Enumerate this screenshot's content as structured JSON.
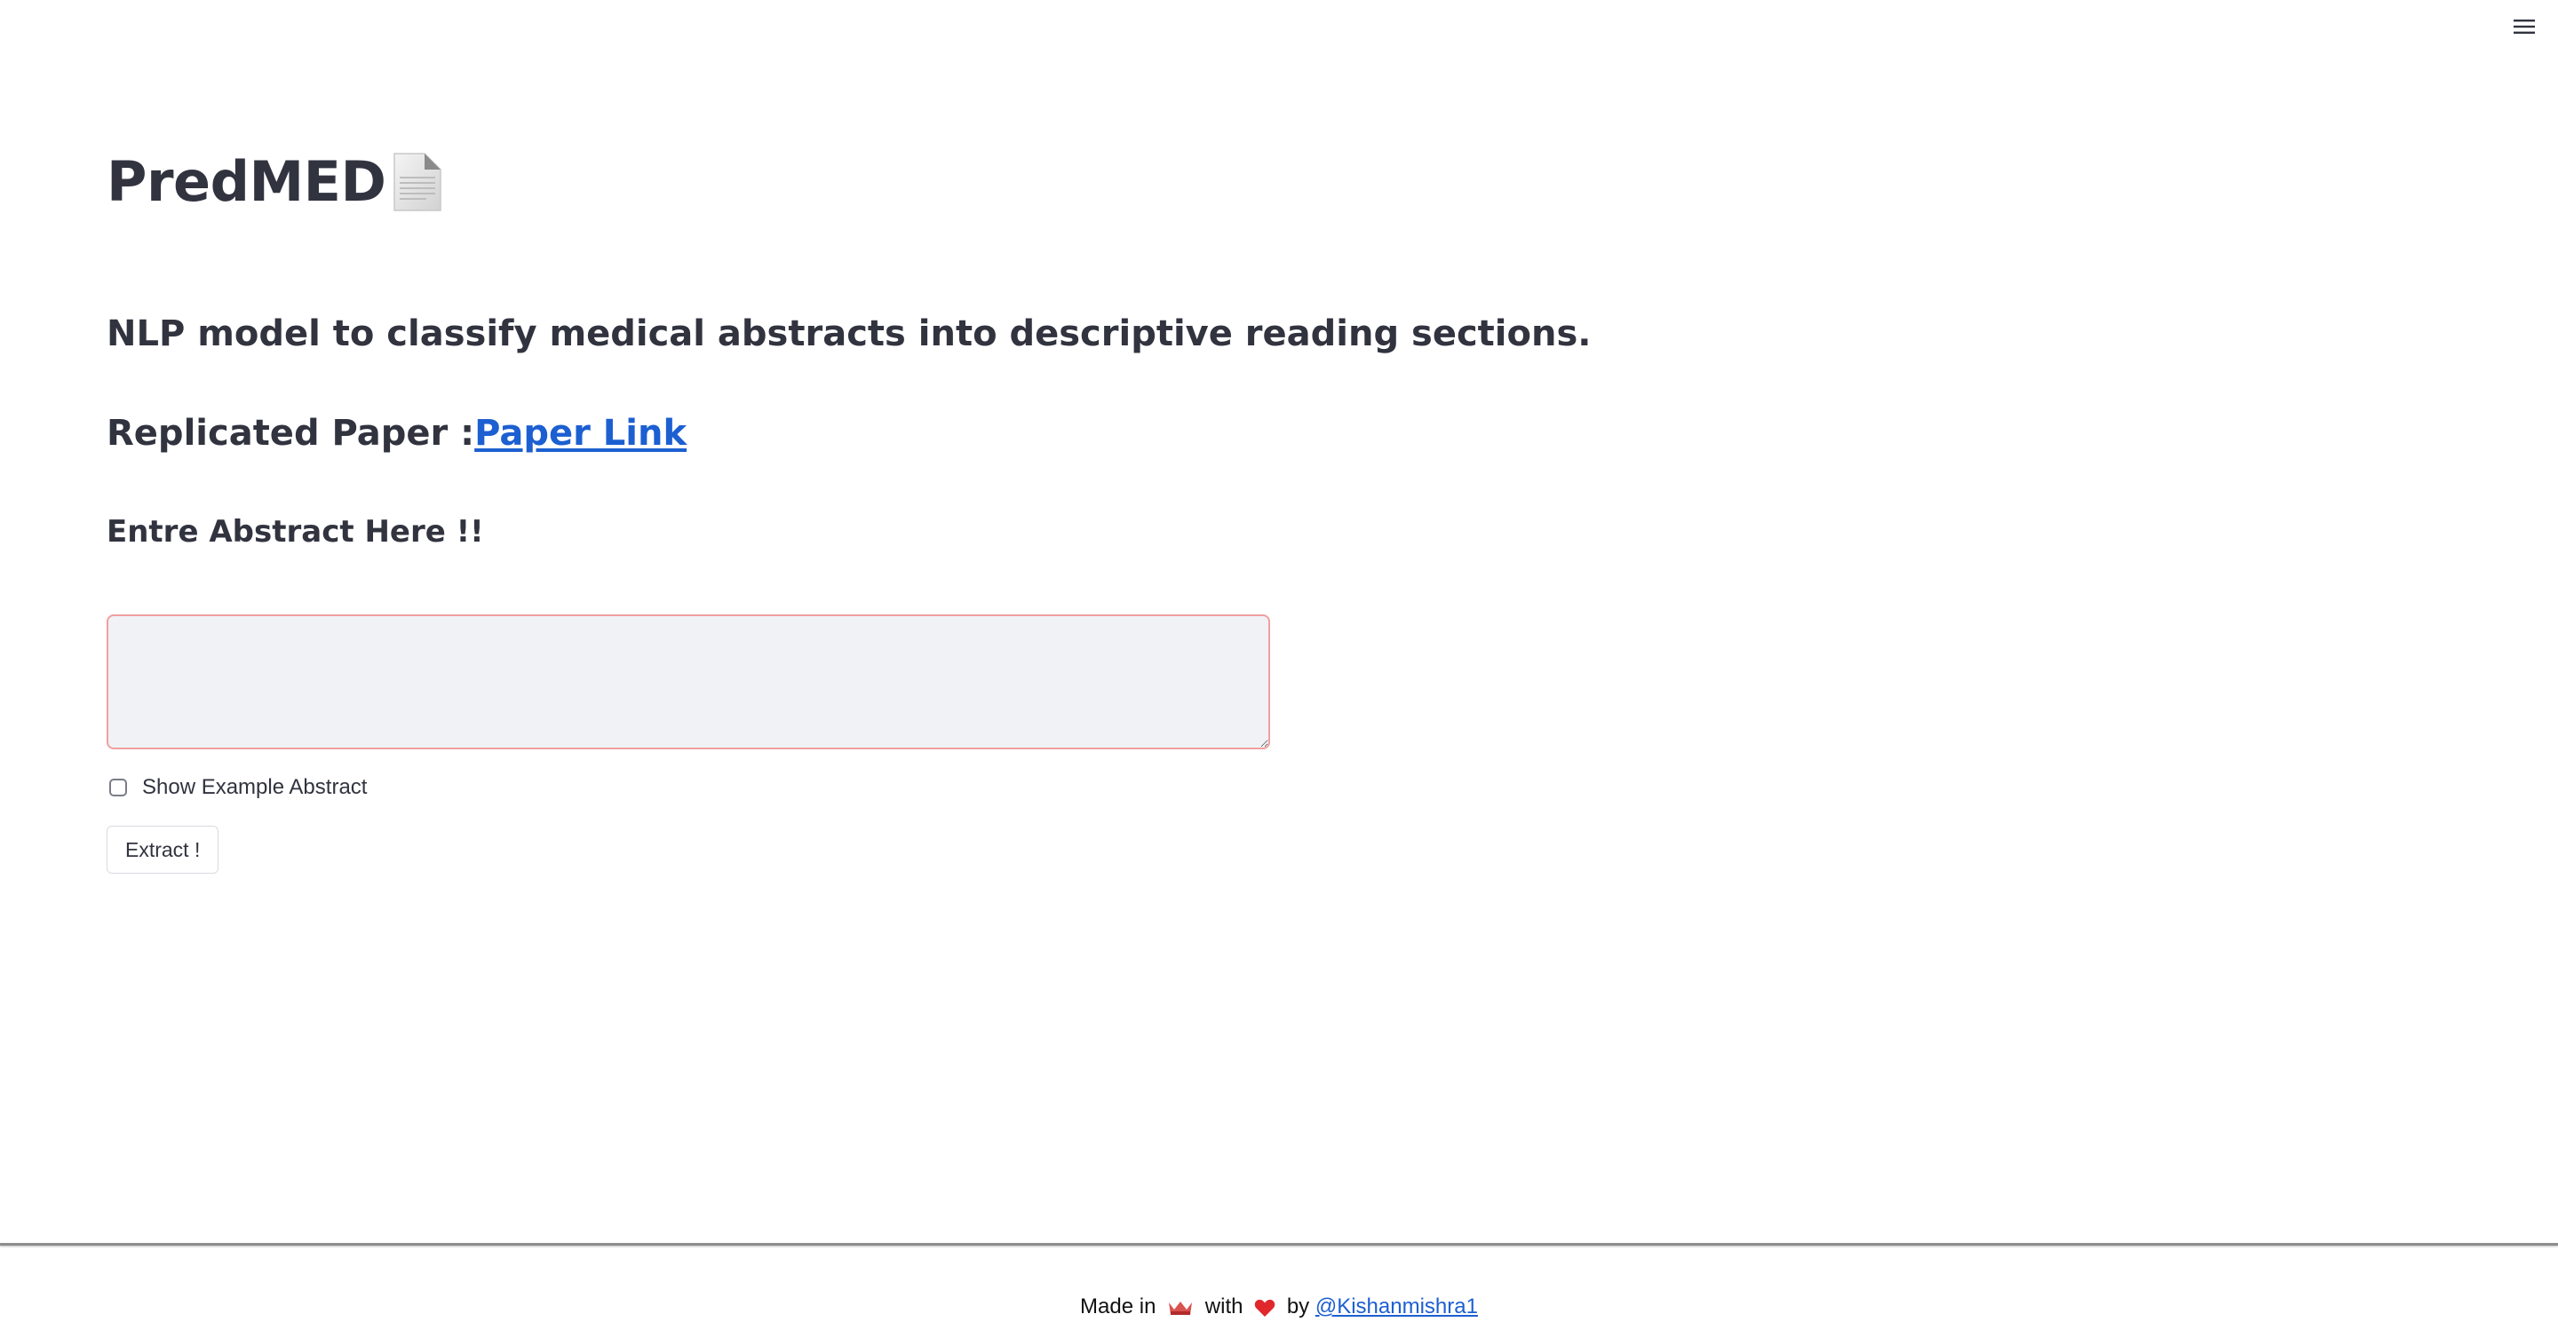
{
  "header": {
    "menu_icon": "hamburger-menu-icon"
  },
  "main": {
    "title": "PredMED",
    "title_icon": "document-icon",
    "subtitle": "NLP model to classify medical abstracts into descriptive reading sections.",
    "paper": {
      "prefix": "Replicated Paper :",
      "link_label": "Paper Link"
    },
    "abstract_heading": "Entre Abstract Here !!",
    "abstract_input": {
      "value": "",
      "placeholder": ""
    },
    "example_checkbox": {
      "label": "Show Example Abstract",
      "checked": false
    },
    "extract_button_label": "Extract !"
  },
  "footer": {
    "made_in": "Made in",
    "flag_icon": "flag-icon",
    "with": "with",
    "heart_icon": "heart-icon",
    "by": "by",
    "author_link": "@Kishanmishra1"
  },
  "colors": {
    "text": "#31333f",
    "link": "#1c5fd1",
    "input_bg": "#f0f2f6",
    "input_border": "#f0a0a0"
  }
}
